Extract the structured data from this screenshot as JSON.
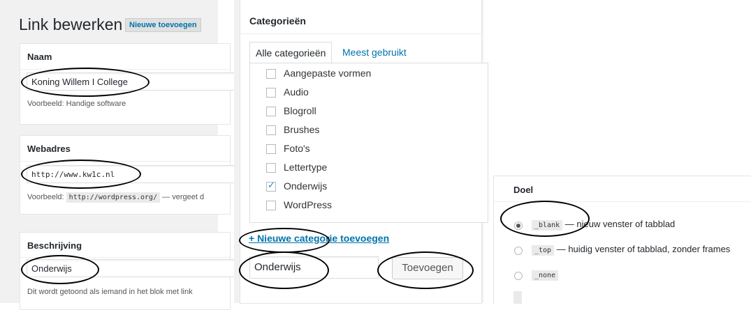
{
  "edit_panel": {
    "title": "Link bewerken",
    "add_new_button": "Nieuwe toevoegen",
    "name_section": {
      "label": "Naam",
      "value": "Koning Willem I College",
      "help": "Voorbeeld: Handige software"
    },
    "url_section": {
      "label": "Webadres",
      "value": "http://www.kw1c.nl",
      "help_prefix": "Voorbeeld:",
      "help_code": "http://wordpress.org/",
      "help_suffix": "— vergeet d"
    },
    "desc_section": {
      "label": "Beschrijving",
      "value": "Onderwijs",
      "help": "Dit wordt getoond als iemand in het blok met link"
    }
  },
  "categories_panel": {
    "title": "Categorieën",
    "tabs": [
      "Alle categorieën",
      "Meest gebruikt"
    ],
    "items": [
      {
        "label": "Aangepaste vormen",
        "checked": false
      },
      {
        "label": "Audio",
        "checked": false
      },
      {
        "label": "Blogroll",
        "checked": false
      },
      {
        "label": "Brushes",
        "checked": false
      },
      {
        "label": "Foto's",
        "checked": false
      },
      {
        "label": "Lettertype",
        "checked": false
      },
      {
        "label": "Onderwijs",
        "checked": true
      },
      {
        "label": "WordPress",
        "checked": false
      }
    ],
    "add_new_link": "+ Nieuwe categorie toevoegen",
    "new_category_value": "Onderwijs",
    "add_button": "Toevoegen"
  },
  "target_panel": {
    "title": "Doel",
    "options": [
      {
        "code": "_blank",
        "desc": "— nieuw venster of tabblad",
        "selected": true
      },
      {
        "code": "_top",
        "desc": "— huidig venster of tabblad, zonder frames",
        "selected": false
      },
      {
        "code": "_none",
        "desc": "",
        "selected": false
      }
    ]
  },
  "colors": {
    "link": "#0073aa",
    "checkbox": "#1e8cbe",
    "panel_bg": "#f1f1f1"
  }
}
